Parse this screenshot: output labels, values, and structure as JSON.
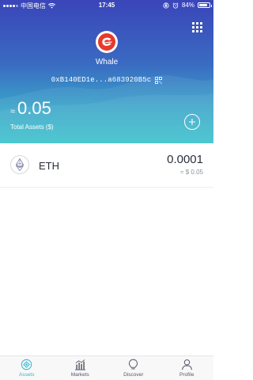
{
  "status_bar": {
    "carrier": "中国电信",
    "time": "17:45",
    "battery": "84%",
    "battery_level": 0.84
  },
  "wallet": {
    "name": "Whale",
    "address": "0xB140ED1e...a683920B5c"
  },
  "balance": {
    "approx_symbol": "≈",
    "amount": "0.05",
    "label": "Total Assets ($)"
  },
  "assets": [
    {
      "symbol": "ETH",
      "icon": "ethereum-icon",
      "amount": "0.0001",
      "fiat": "≈ $ 0.05"
    }
  ],
  "tabs": [
    {
      "label": "Assets",
      "icon": "assets-icon",
      "active": true
    },
    {
      "label": "Markets",
      "icon": "markets-icon",
      "active": false
    },
    {
      "label": "Discover",
      "icon": "discover-icon",
      "active": false
    },
    {
      "label": "Profile",
      "icon": "profile-icon",
      "active": false
    }
  ],
  "colors": {
    "accent": "#35b6cf",
    "header_top": "#3a45b9",
    "header_bottom": "#35c1cb",
    "avatar_logo": "#e8392b"
  }
}
